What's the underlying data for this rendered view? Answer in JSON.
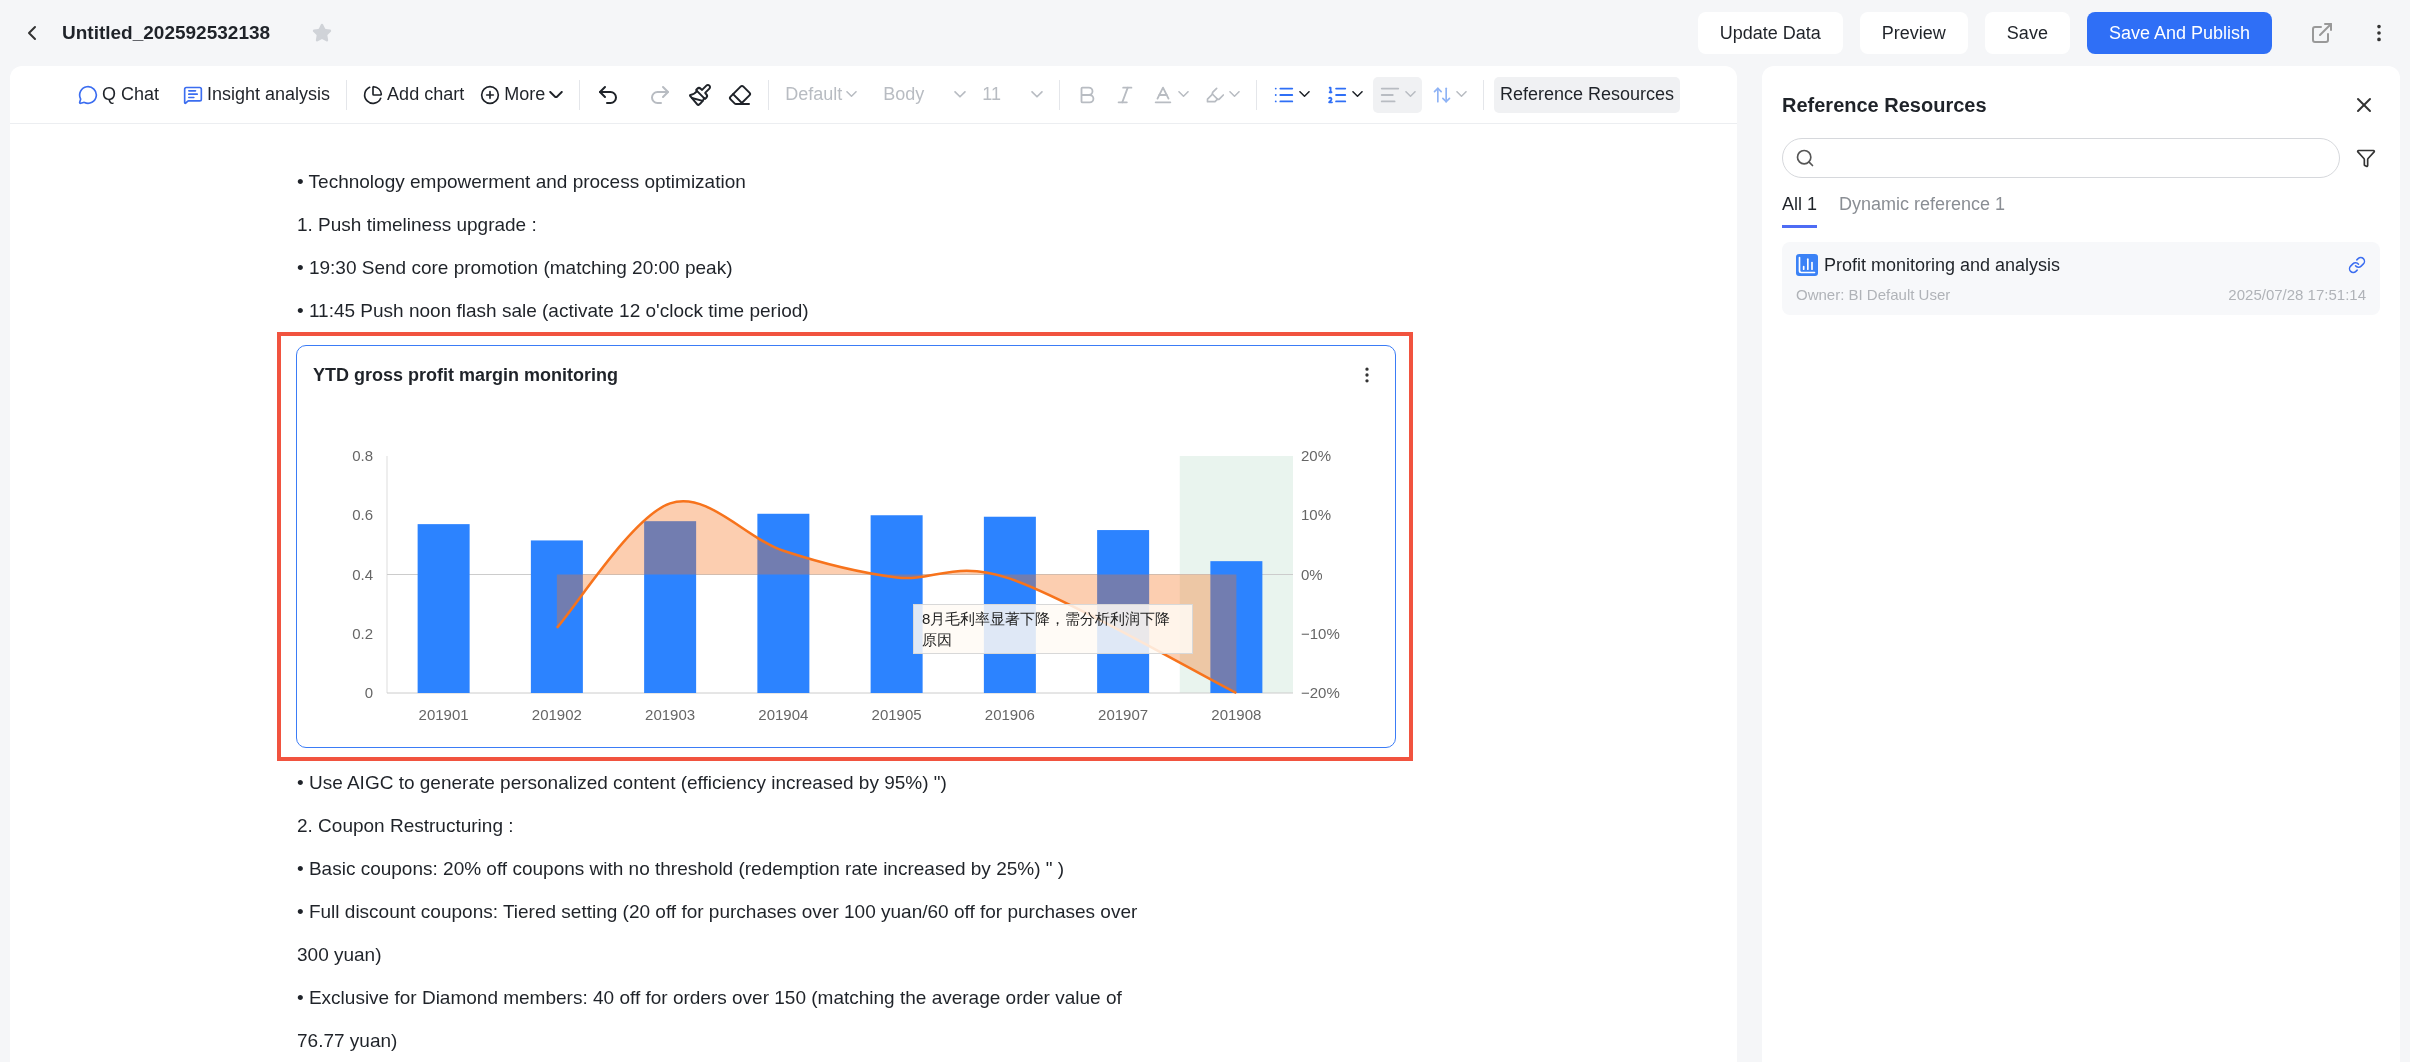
{
  "header": {
    "title": "Untitled_202592532138",
    "starred": false,
    "buttons": [
      {
        "label": "Update Data",
        "primary": false
      },
      {
        "label": "Preview",
        "primary": false
      },
      {
        "label": "Save",
        "primary": false
      },
      {
        "label": "Save And Publish",
        "primary": true
      }
    ]
  },
  "toolbar": {
    "q_chat": "Q Chat",
    "insight": "Insight analysis",
    "add_chart": "Add chart",
    "more": "More",
    "redo": {
      "disabled": true
    },
    "font": {
      "value": "Default",
      "disabled": true
    },
    "style": {
      "value": "Body",
      "disabled": true
    },
    "size": {
      "value": "11",
      "disabled": true
    },
    "align": {
      "disabled": true
    },
    "reference": "Reference Resources"
  },
  "document": {
    "blocks": [
      {
        "kind": "paragraph",
        "text": "• Technology empowerment and process optimization"
      },
      {
        "kind": "paragraph",
        "text": "1. Push timeliness upgrade :"
      },
      {
        "kind": "paragraph",
        "text": "• 19:30 Send core promotion (matching 20:00 peak)"
      },
      {
        "kind": "paragraph",
        "text": "• 11:45 Push noon flash sale (activate 12 o'clock time period)"
      },
      {
        "kind": "chart",
        "title": "YTD gross profit margin monitoring",
        "highlighted": true,
        "chart_data": {
          "type": "bar",
          "categories": [
            "201901",
            "201902",
            "201903",
            "201904",
            "201905",
            "201906",
            "201907",
            "201908"
          ],
          "ylim": [
            0,
            0.8
          ],
          "yticks": [
            0,
            {
              "value": 0.2,
              "label": "0.2"
            },
            {
              "value": 0.4,
              "label": "0.4"
            },
            {
              "value": 0.6,
              "label": "0.6"
            },
            {
              "value": 0.8,
              "label": "0.8"
            }
          ],
          "y2lim": [
            -0.2,
            0.2
          ],
          "y2ticks": [
            {
              "value": 0.2,
              "label": "20%"
            },
            {
              "value": 0.1,
              "label": "10%"
            },
            {
              "value": 0,
              "label": "0%"
            },
            {
              "value": -0.1,
              "label": "−10%"
            },
            {
              "value": -0.2,
              "label": "−20%"
            }
          ],
          "series": [
            {
              "color": "#2c83ff",
              "values": [
                0.57,
                0.515,
                0.58,
                0.605,
                0.6,
                0.595,
                0.55,
                0.445
              ]
            },
            {
              "type": "area",
              "axis": "y2",
              "color": "#f7731c",
              "values": [
                null,
                -0.09,
                0.12,
                0.04,
                -0.005,
                -0.007,
                null,
                -0.2
              ]
            }
          ],
          "annotations": [
            {
              "text": "8月毛利率显著下降，需分析利润下降原因"
            }
          ]
        }
      },
      {
        "kind": "paragraph",
        "text": "• Use AIGC to generate personalized content (efficiency increased by 95%) \")"
      },
      {
        "kind": "paragraph",
        "text": "2. Coupon Restructuring :"
      },
      {
        "kind": "paragraph",
        "text": "• Basic coupons: 20% off coupons with no threshold (redemption rate increased by 25%) \" )"
      },
      {
        "kind": "paragraph",
        "text": "• Full discount coupons: Tiered setting (20 off for purchases over 100 yuan/60 off for purchases over 300 yuan)"
      },
      {
        "kind": "paragraph",
        "text": "• Exclusive for Diamond members: 40 off for orders over 150 (matching the average order value of 76.77 yuan)"
      }
    ]
  },
  "panel": {
    "title": "Reference Resources",
    "tabs": [
      {
        "label": "All 1",
        "selected": true
      },
      {
        "label": "Dynamic reference 1",
        "selected": false
      }
    ],
    "items": [
      {
        "title": "Profit monitoring and analysis",
        "owner": "Owner: BI Default User",
        "time": "2025/07/28 17:51:14"
      }
    ]
  }
}
